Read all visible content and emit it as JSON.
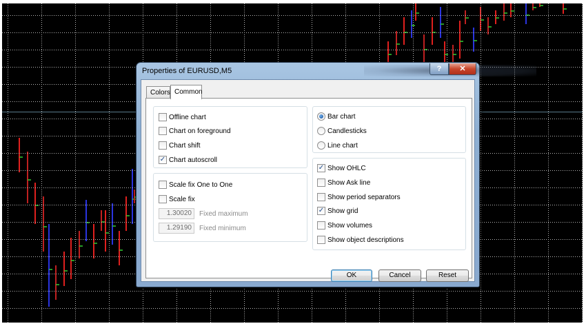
{
  "window": {
    "title": "Properties of EURUSD,M5",
    "help_glyph": "?",
    "close_glyph": "✕"
  },
  "tabs": [
    {
      "label": "Colors",
      "active": false
    },
    {
      "label": "Common",
      "active": true
    }
  ],
  "chart_options": [
    {
      "label": "Offline chart",
      "checked": false
    },
    {
      "label": "Chart on foreground",
      "checked": false,
      "highlighted": true
    },
    {
      "label": "Chart shift",
      "checked": false
    },
    {
      "label": "Chart autoscroll",
      "checked": true
    }
  ],
  "scale_options": [
    {
      "label": "Scale fix One to One",
      "checked": false
    },
    {
      "label": "Scale fix",
      "checked": false
    }
  ],
  "fixed_fields": [
    {
      "value": "1.30020",
      "label": "Fixed maximum"
    },
    {
      "value": "1.29190",
      "label": "Fixed minimum"
    }
  ],
  "chart_type": [
    {
      "label": "Bar chart",
      "selected": true
    },
    {
      "label": "Candlesticks",
      "selected": false
    },
    {
      "label": "Line chart",
      "selected": false
    }
  ],
  "show_options": [
    {
      "label": "Show OHLC",
      "checked": true
    },
    {
      "label": "Show Ask line",
      "checked": false
    },
    {
      "label": "Show period separators",
      "checked": false
    },
    {
      "label": "Show grid",
      "checked": true
    },
    {
      "label": "Show volumes",
      "checked": false
    },
    {
      "label": "Show object descriptions",
      "checked": false
    }
  ],
  "buttons": {
    "ok": "OK",
    "cancel": "Cancel",
    "reset": "Reset"
  },
  "colors": {
    "highlight": "#f4f545",
    "bull_bar": "#e0201e",
    "bear_bar": "#2a34e0",
    "close_tick": "#33cc33",
    "chart_bg": "#000000"
  },
  "check_glyph": "✓"
}
